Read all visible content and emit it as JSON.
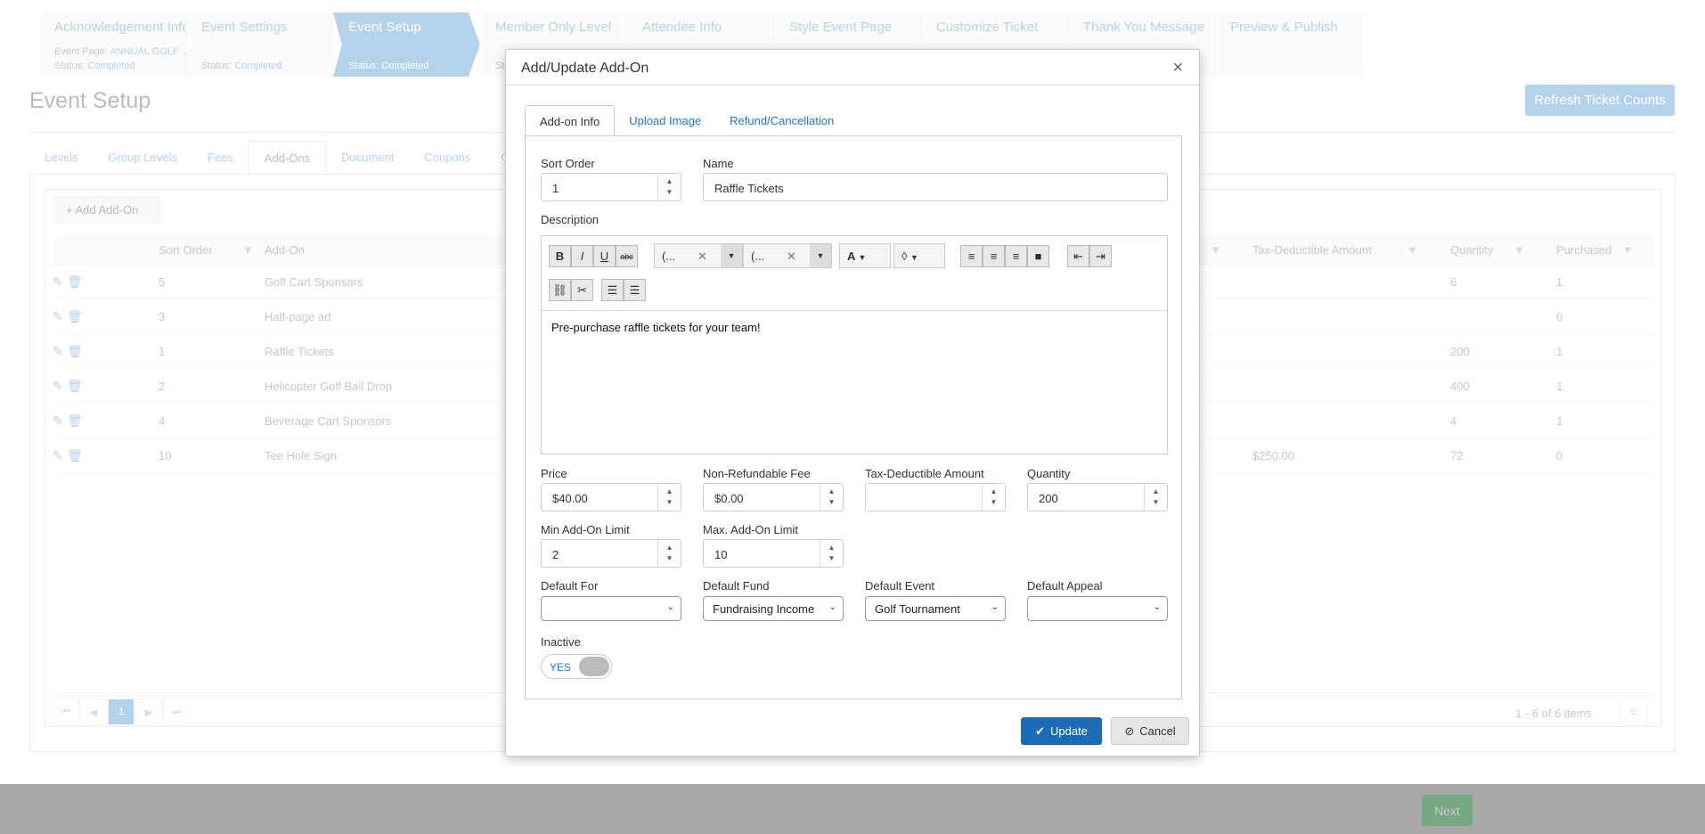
{
  "steps": [
    {
      "title": "Acknowledgement Info",
      "page_label": "Event Page:",
      "page_value": "ANNUAL GOLF ...",
      "status_label": "Status:",
      "status_value": "Completed"
    },
    {
      "title": "Event Settings",
      "status_label": "Status:",
      "status_value": "Completed"
    },
    {
      "title": "Event Setup",
      "status_label": "Status:",
      "status_value": "Completed"
    },
    {
      "title": "Member Only Level",
      "status_label": "Stat"
    },
    {
      "title": "Attendee Info"
    },
    {
      "title": "Style Event Page"
    },
    {
      "title": "Customize Ticket"
    },
    {
      "title": "Thank You Message"
    },
    {
      "title": "Preview & Publish"
    }
  ],
  "page": {
    "title": "Event Setup",
    "refresh": "Refresh Ticket Counts",
    "next": "Next"
  },
  "tabs": [
    "Levels",
    "Group Levels",
    "Fees",
    "Add-Ons",
    "Document",
    "Coupons",
    "Gif"
  ],
  "grid": {
    "add_button": "+ Add Add-On",
    "headers": {
      "sort": "Sort Order",
      "addon": "Add-On",
      "tax": "Tax-Deductible Amount",
      "qty": "Quantity",
      "purchased": "Purchased"
    },
    "rows": [
      {
        "sort": "5",
        "name": "Golf Cart Sponsors",
        "tax": "",
        "qty": "6",
        "purchased": "1"
      },
      {
        "sort": "3",
        "name": "Half-page ad",
        "tax": "",
        "qty": "",
        "purchased": "0"
      },
      {
        "sort": "1",
        "name": "Raffle Tickets",
        "tax": "",
        "qty": "200",
        "purchased": "1"
      },
      {
        "sort": "2",
        "name": "Helicopter Golf Ball Drop",
        "tax": "",
        "qty": "400",
        "purchased": "1"
      },
      {
        "sort": "4",
        "name": "Beverage Cart Sponsors",
        "tax": "",
        "qty": "4",
        "purchased": "1"
      },
      {
        "sort": "10",
        "name": "Tee Hole Sign",
        "tax": "$250.00",
        "qty": "72",
        "purchased": "0"
      }
    ],
    "page": "1",
    "items": "1 - 6 of 6 items"
  },
  "modal": {
    "title": "Add/Update Add-On",
    "tabs": [
      "Add-on Info",
      "Upload Image",
      "Refund/Cancellation"
    ],
    "sort_order_label": "Sort Order",
    "sort_order": "1",
    "name_label": "Name",
    "name": "Raffle Tickets",
    "description_label": "Description",
    "font_dd": "(...",
    "size_dd": "(...",
    "description": "Pre-purchase raffle tickets for your team!",
    "price_label": "Price",
    "price": "$40.00",
    "nrf_label": "Non-Refundable Fee",
    "nrf": "$0.00",
    "tax_label": "Tax-Deductible Amount",
    "tax": "",
    "qty_label": "Quantity",
    "qty": "200",
    "min_label": "Min Add-On Limit",
    "min": "2",
    "max_label": "Max. Add-On Limit",
    "max": "10",
    "dfor_label": "Default For",
    "dfor": "",
    "dfund_label": "Default Fund",
    "dfund": "Fundraising Income",
    "devent_label": "Default Event",
    "devent": "Golf Tournament",
    "dappeal_label": "Default Appeal",
    "dappeal": "",
    "inactive_label": "Inactive",
    "inactive": "YES",
    "update": "Update",
    "cancel": "Cancel"
  }
}
